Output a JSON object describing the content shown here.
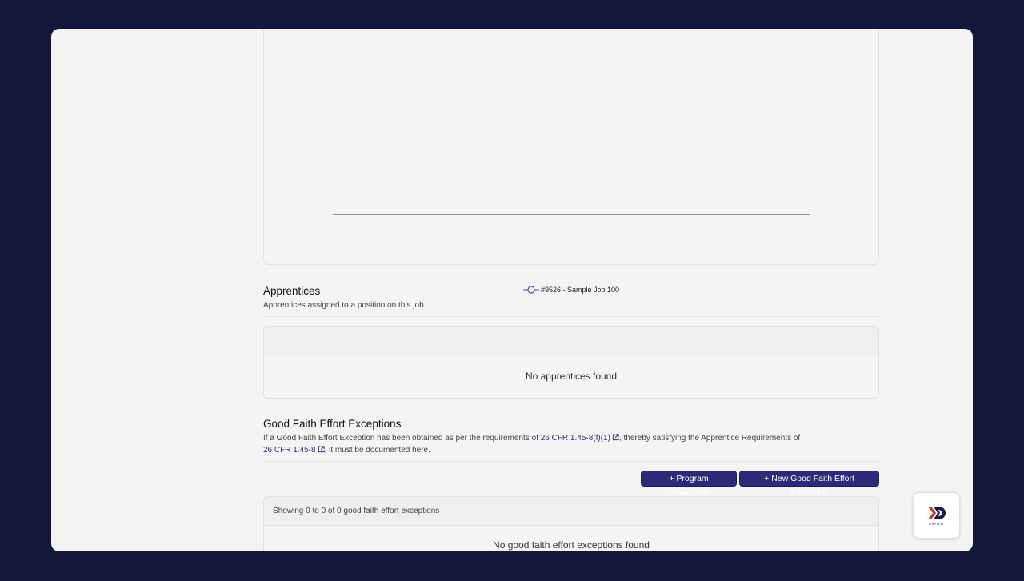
{
  "chart": {
    "legend_label": "#9526 - Sample Job 100",
    "series_color": "#4a5096"
  },
  "apprentices": {
    "title": "Apprentices",
    "description": "Apprentices assigned to a position on this job.",
    "empty_text": "No apprentices found"
  },
  "gfe": {
    "title": "Good Faith Effort Exceptions",
    "desc_part1": "If a Good Faith Effort Exception has been obtained as per the requirements of ",
    "link1": "26 CFR 1.45-8(f)(1)",
    "desc_part2": ", thereby satisfying the Apprentice Requirements of",
    "link2": "26 CFR 1.45-8",
    "desc_part3": ", it must be documented here.",
    "btn_program_unavailable": "+ Program Unavailable",
    "btn_new_exception": "+ New Good Faith Effort Exception",
    "showing_text": "Showing 0 to 0 of 0 good faith effort exceptions",
    "empty_text": "No good faith effort exceptions found"
  },
  "fab": {
    "logo_text": "DSPTCH",
    "accent_color": "#c0392b",
    "dark_color": "#1a1a4a"
  },
  "colors": {
    "background": "#12163a",
    "panel": "#f4f4f4",
    "button": "#2b2b7a",
    "link": "#2a2d78"
  }
}
